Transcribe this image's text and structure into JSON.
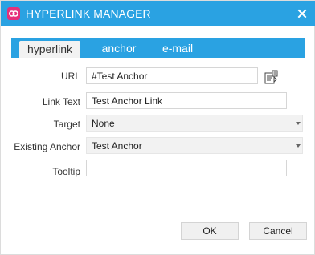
{
  "window": {
    "title": "HYPERLINK MANAGER",
    "close_glyph": "×",
    "brand_color": "#2aa2e2",
    "logo_color": "#e5307a"
  },
  "tabs": [
    {
      "label": "hyperlink",
      "active": true
    },
    {
      "label": "anchor",
      "active": false
    },
    {
      "label": "e-mail",
      "active": false
    }
  ],
  "form": {
    "url": {
      "label": "URL",
      "value": "#Test Anchor"
    },
    "link_text": {
      "label": "Link Text",
      "value": "Test Anchor Link"
    },
    "target": {
      "label": "Target",
      "value": "None"
    },
    "existing_anchor": {
      "label": "Existing Anchor",
      "value": "Test Anchor"
    },
    "tooltip": {
      "label": "Tooltip",
      "value": ""
    }
  },
  "buttons": {
    "ok": "OK",
    "cancel": "Cancel"
  },
  "icons": {
    "title_logo": "link-logo-icon",
    "close": "close-icon",
    "url_browse": "document-manager-icon",
    "dropdown": "chevron-down-icon"
  }
}
